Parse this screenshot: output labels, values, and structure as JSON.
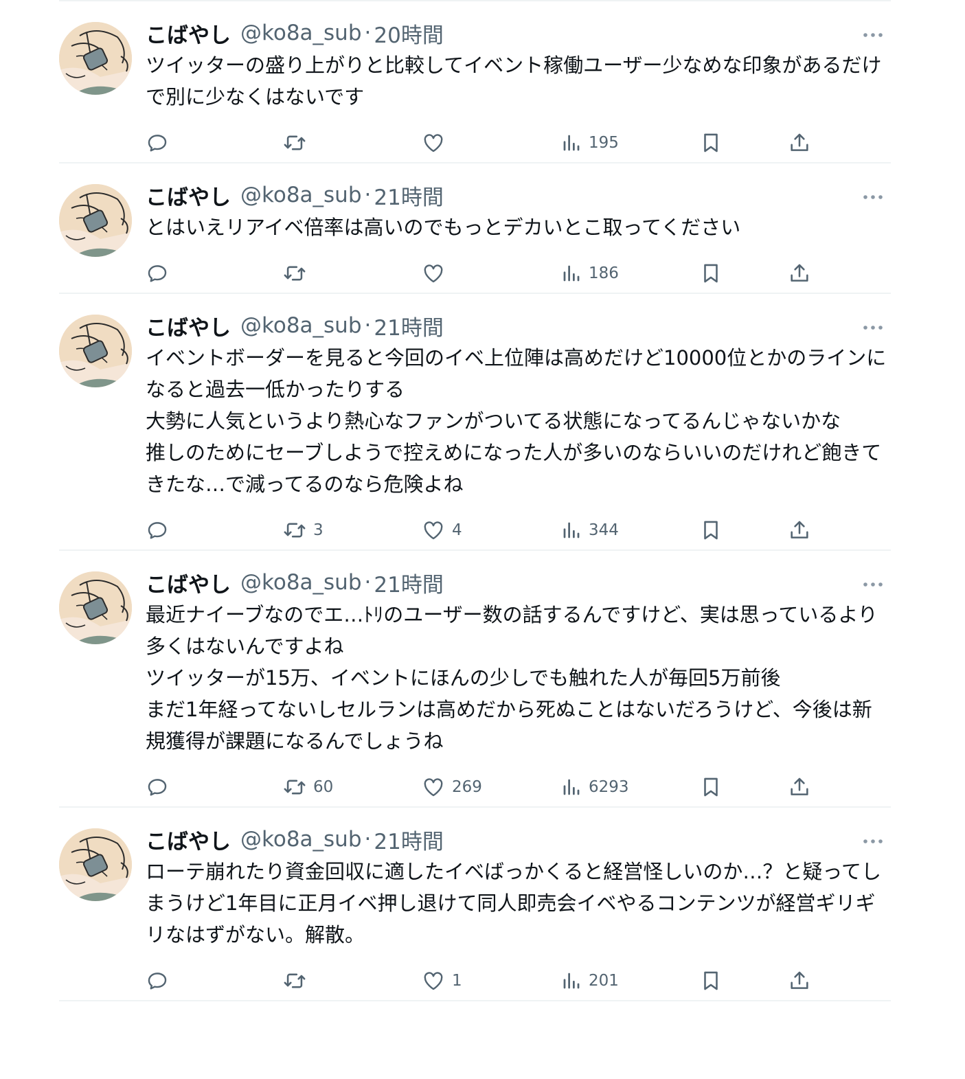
{
  "tweets": [
    {
      "name": "こばやし",
      "handle": "@ko8a_sub",
      "separator": "·",
      "time": "20時間",
      "text": "ツイッターの盛り上がりと比較してイベント稼働ユーザー少なめな印象があるだけで別に少なくはないです",
      "retweets": "",
      "likes": "",
      "views": "195"
    },
    {
      "name": "こばやし",
      "handle": "@ko8a_sub",
      "separator": "·",
      "time": "21時間",
      "text": "とはいえリアイベ倍率は高いのでもっとデカいとこ取ってください",
      "retweets": "",
      "likes": "",
      "views": "186"
    },
    {
      "name": "こばやし",
      "handle": "@ko8a_sub",
      "separator": "·",
      "time": "21時間",
      "text": "イベントボーダーを見ると今回のイベ上位陣は高めだけど10000位とかのラインになると過去一低かったりする\n大勢に人気というより熱心なファンがついてる状態になってるんじゃないかな\n推しのためにセーブしようで控えめになった人が多いのならいいのだけれど飽きてきたな…で減ってるのなら危険よね",
      "retweets": "3",
      "likes": "4",
      "views": "344"
    },
    {
      "name": "こばやし",
      "handle": "@ko8a_sub",
      "separator": "·",
      "time": "21時間",
      "text": "最近ナイーブなのでエ…ﾄﾘのユーザー数の話するんですけど、実は思っているより多くはないんですよね\nツイッターが15万、イベントにほんの少しでも触れた人が毎回5万前後\nまだ1年経ってないしセルランは高めだから死ぬことはないだろうけど、今後は新規獲得が課題になるんでしょうね",
      "retweets": "60",
      "likes": "269",
      "views": "6293"
    },
    {
      "name": "こばやし",
      "handle": "@ko8a_sub",
      "separator": "·",
      "time": "21時間",
      "text": "ローテ崩れたり資金回収に適したイベばっかくると経営怪しいのか…？と疑ってしまうけど1年目に正月イベ押し退けて同人即売会イベやるコンテンツが経営ギリギリなはずがない。解散。",
      "retweets": "",
      "likes": "1",
      "views": "201"
    }
  ],
  "icons": {
    "avatar": "avatar-illustration",
    "more": "more-icon",
    "reply": "reply-icon",
    "retweet": "retweet-icon",
    "like": "heart-icon",
    "views": "views-icon",
    "bookmark": "bookmark-icon",
    "share": "share-icon"
  },
  "colors": {
    "text": "#0f1419",
    "secondary": "#536471",
    "divider": "#eff3f4"
  }
}
